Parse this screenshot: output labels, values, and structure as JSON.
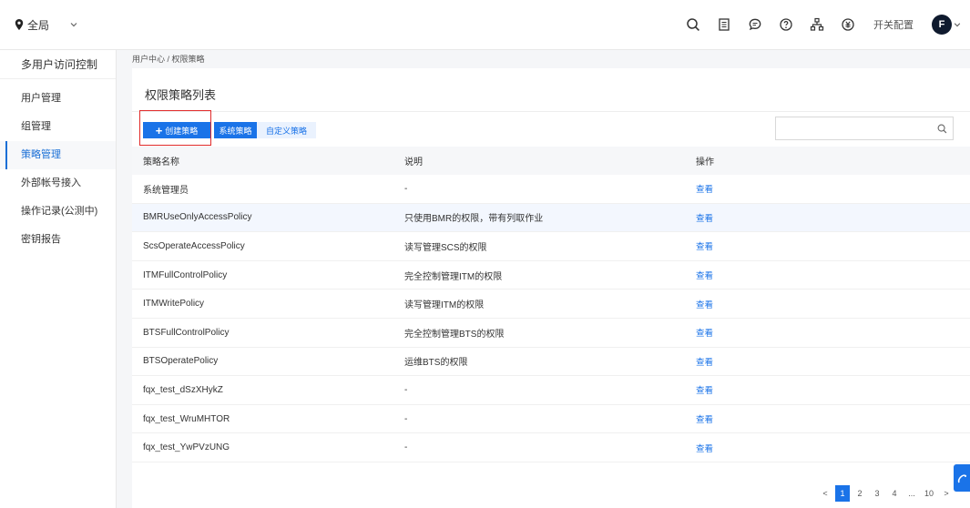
{
  "topbar": {
    "region_label": "全局",
    "switch_config_label": "开关配置",
    "avatar_initial": "F"
  },
  "sidebar": {
    "title": "多用户访问控制",
    "items": [
      {
        "label": "用户管理",
        "active": false
      },
      {
        "label": "组管理",
        "active": false
      },
      {
        "label": "策略管理",
        "active": true
      },
      {
        "label": "外部帐号接入",
        "active": false
      },
      {
        "label": "操作记录(公测中)",
        "active": false
      },
      {
        "label": "密钥报告",
        "active": false
      }
    ]
  },
  "breadcrumb": "用户中心 /  权限策略",
  "main": {
    "title": "权限策略列表",
    "create_button": "创建策略",
    "system_tab": "系统策略",
    "custom_tab": "自定义策略",
    "search_placeholder": ""
  },
  "table": {
    "headers": [
      "策略名称",
      "说明",
      "操作"
    ],
    "rows": [
      {
        "name": "系统管理员",
        "desc": "-",
        "action": "查看"
      },
      {
        "name": "BMRUseOnlyAccessPolicy",
        "desc": "只使用BMR的权限，带有列取作业",
        "action": "查看"
      },
      {
        "name": "ScsOperateAccessPolicy",
        "desc": "读写管理SCS的权限",
        "action": "查看"
      },
      {
        "name": "ITMFullControlPolicy",
        "desc": "完全控制管理ITM的权限",
        "action": "查看"
      },
      {
        "name": "ITMWritePolicy",
        "desc": "读写管理ITM的权限",
        "action": "查看"
      },
      {
        "name": "BTSFullControlPolicy",
        "desc": "完全控制管理BTS的权限",
        "action": "查看"
      },
      {
        "name": "BTSOperatePolicy",
        "desc": "运维BTS的权限",
        "action": "查看"
      },
      {
        "name": "fqx_test_dSzXHykZ",
        "desc": "-",
        "action": "查看"
      },
      {
        "name": "fqx_test_WruMHTOR",
        "desc": "-",
        "action": "查看"
      },
      {
        "name": "fqx_test_YwPVzUNG",
        "desc": "-",
        "action": "查看"
      }
    ]
  },
  "pagination": {
    "prev": "<",
    "pages": [
      "1",
      "2",
      "3",
      "4",
      "...",
      "10"
    ],
    "next": ">",
    "current": "1"
  },
  "colors": {
    "accent": "#1a73e8",
    "highlight_box": "#e12b2b",
    "avatar_bg": "#0f1a2e"
  }
}
